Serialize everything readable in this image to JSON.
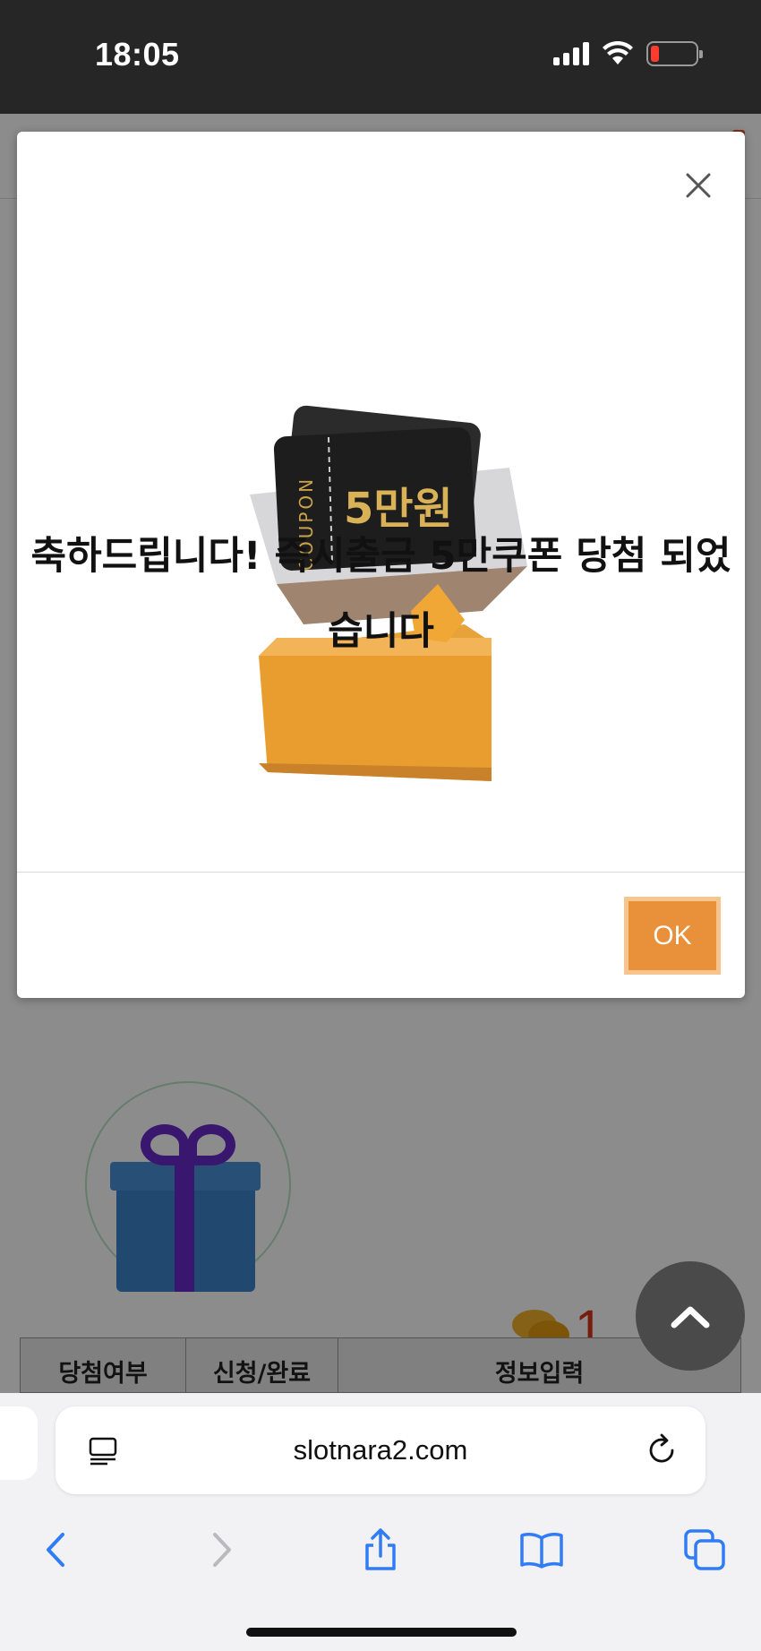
{
  "status_bar": {
    "time": "18:05"
  },
  "background_page": {
    "chat": {
      "count": "1"
    },
    "table_headers": [
      "당첨여부",
      "신청/완료",
      "정보입력"
    ]
  },
  "modal": {
    "coupon_label": "COUPON",
    "coupon_value": "5만원",
    "message": "축하드립니다! 즉시출금 5만쿠폰 당첨 되었습니다",
    "ok_label": "OK"
  },
  "browser": {
    "url": "slotnara2.com"
  },
  "colors": {
    "accent": "#e8903a",
    "status_bar": "#262626",
    "link_blue": "#2f7cf6"
  }
}
